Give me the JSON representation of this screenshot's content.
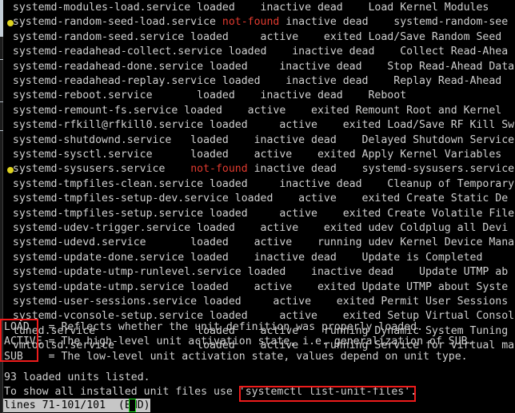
{
  "terminal": {
    "background_color": "#000000",
    "foreground_color": "#cfcfcf",
    "not_found_color": "#e03a2f",
    "bullet_color": "#ded31f",
    "annotation_color": "#ee1b1b",
    "status_bg_color": "#c6c6c6",
    "status_fg_color": "#000000",
    "cursor_color": "#21e621"
  },
  "unit_lines": [
    {
      "bullet": false,
      "text": "  systemd-modules-load.service loaded    inactive dead    Load Kernel Modules"
    },
    {
      "bullet": true,
      "pre": "  systemd-random-seed-load.service ",
      "nf": "not-found",
      "post": " inactive dead    systemd-random-see"
    },
    {
      "bullet": false,
      "text": "  systemd-random-seed.service loaded     active    exited Load/Save Random Seed"
    },
    {
      "bullet": false,
      "text": "  systemd-readahead-collect.service loaded    inactive dead    Collect Read-Ahea"
    },
    {
      "bullet": false,
      "text": "  systemd-readahead-done.service loaded     inactive dead    Stop Read-Ahead Data"
    },
    {
      "bullet": false,
      "text": "  systemd-readahead-replay.service loaded    inactive dead    Replay Read-Ahead"
    },
    {
      "bullet": false,
      "text": "  systemd-reboot.service       loaded    inactive dead    Reboot"
    },
    {
      "bullet": false,
      "text": "  systemd-remount-fs.service loaded    active    exited Remount Root and Kernel"
    },
    {
      "bullet": false,
      "text": "  systemd-rfkill@rfkill0.service loaded     active    exited Load/Save RF Kill Sw"
    },
    {
      "bullet": false,
      "text": "  systemd-shutdownd.service   loaded    inactive dead    Delayed Shutdown Service"
    },
    {
      "bullet": false,
      "text": "  systemd-sysctl.service      loaded    active    exited Apply Kernel Variables"
    },
    {
      "bullet": true,
      "pre": "  systemd-sysusers.service    ",
      "nf": "not-found",
      "post": " inactive dead    systemd-sysusers.service"
    },
    {
      "bullet": false,
      "text": "  systemd-tmpfiles-clean.service loaded     inactive dead    Cleanup of Temporary"
    },
    {
      "bullet": false,
      "text": "  systemd-tmpfiles-setup-dev.service loaded    active    exited Create Static De"
    },
    {
      "bullet": false,
      "text": "  systemd-tmpfiles-setup.service loaded     active    exited Create Volatile File"
    },
    {
      "bullet": false,
      "text": "  systemd-udev-trigger.service loaded    active    exited udev Coldplug all Devi"
    },
    {
      "bullet": false,
      "text": "  systemd-udevd.service       loaded    active    running udev Kernel Device Manag"
    },
    {
      "bullet": false,
      "text": "  systemd-update-done.service loaded    inactive dead    Update is Completed"
    },
    {
      "bullet": false,
      "text": "  systemd-update-utmp-runlevel.service loaded    inactive dead    Update UTMP ab"
    },
    {
      "bullet": false,
      "text": "  systemd-update-utmp.service loaded    active    exited Update UTMP about Syste"
    },
    {
      "bullet": false,
      "text": "  systemd-user-sessions.service loaded     active    exited Permit User Sessions"
    },
    {
      "bullet": false,
      "text": "  systemd-vconsole-setup.service loaded     active    exited Setup Virtual Consol"
    },
    {
      "bullet": false,
      "text": "  tuned.service                loaded    active    running Dynamic System Tuning Da"
    },
    {
      "bullet": false,
      "text": "  vmtoolsd.service             loaded    active    running Service for virtual mach"
    }
  ],
  "legend": {
    "rows": [
      {
        "key": "LOAD",
        "keypad": "LOAD   ",
        "desc": "= Reflects whether the unit definition was properly loaded."
      },
      {
        "key": "ACTIVE",
        "keypad": "ACTIVE ",
        "desc": "= The high-level unit activation state, i.e. generalization of SUB."
      },
      {
        "key": "SUB",
        "keypad": "SUB    ",
        "desc": "= The low-level unit activation state, values depend on unit type."
      }
    ]
  },
  "summary": {
    "count_line": "93 loaded units listed.",
    "hint_prefix": "To show all installed unit files use ",
    "hint_command": "'systemctl list-unit-files'",
    "hint_suffix": "."
  },
  "pager": {
    "status": "lines 71-101/101  (END)"
  }
}
